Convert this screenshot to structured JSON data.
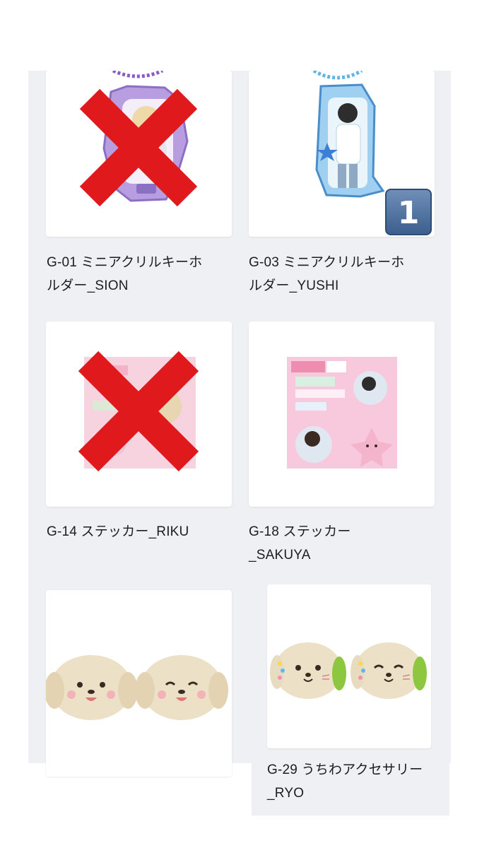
{
  "products": [
    {
      "line1": "G-01 ミニアクリルキーホ",
      "line2": "ルダー_SION",
      "status": "sold-out"
    },
    {
      "line1": "G-03 ミニアクリルキーホ",
      "line2": "ルダー_YUSHI",
      "status": "owned",
      "quantity": "1"
    },
    {
      "line1": "G-14 ステッカー_RIKU",
      "line2": "",
      "status": "sold-out"
    },
    {
      "line1": "G-18 ステッカー",
      "line2": "_SAKUYA",
      "status": "available"
    },
    {
      "line1": "",
      "line2": "",
      "status": "available"
    },
    {
      "line1": "G-29 うちわアクセサリー",
      "line2": "_RYO",
      "status": "available"
    }
  ],
  "colors": {
    "panel": "#eff0f4",
    "cross": "#e0191c",
    "badge": "#4d6e9c"
  }
}
